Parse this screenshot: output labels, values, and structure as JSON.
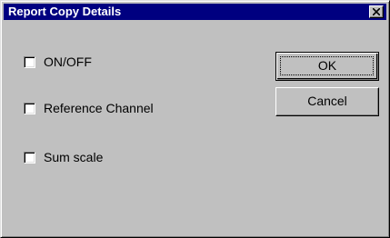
{
  "window": {
    "title": "Report Copy Details",
    "close_icon": "close-icon"
  },
  "options": [
    {
      "label": "ON/OFF",
      "checked": false
    },
    {
      "label": "Reference Channel",
      "checked": false
    },
    {
      "label": "Sum scale",
      "checked": false
    }
  ],
  "buttons": {
    "ok_label": "OK",
    "cancel_label": "Cancel"
  },
  "colors": {
    "titlebar": "#000080",
    "face": "#c0c0c0"
  }
}
